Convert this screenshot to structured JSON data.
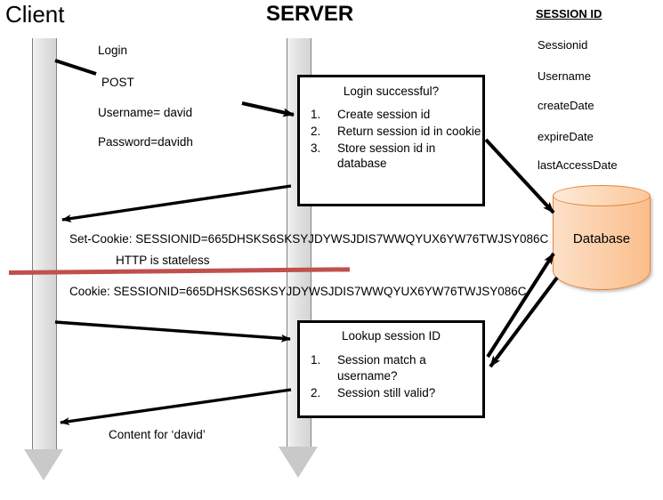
{
  "headings": {
    "client": "Client",
    "server": "SERVER",
    "session": "SESSION ID"
  },
  "session_fields": [
    "Sessionid",
    "Username",
    "createDate",
    "expireDate",
    "lastAccessDate"
  ],
  "client_request": {
    "line1": "Login",
    "line2": "POST",
    "line3": "Username= david",
    "line4": "Password=davidh"
  },
  "server_box_1": {
    "title": "Login successful?",
    "items": [
      {
        "num": "1.",
        "text": "Create session id"
      },
      {
        "num": "2.",
        "text": "Return session id in cookie"
      },
      {
        "num": "3.",
        "text": "Store session id in database"
      }
    ]
  },
  "server_box_2": {
    "title": "Lookup session ID",
    "items": [
      {
        "num": "1.",
        "text": "Session match a username?"
      },
      {
        "num": "2.",
        "text": "Session still valid?"
      }
    ]
  },
  "messages": {
    "set_cookie": "Set-Cookie: SESSIONID=665DHSKS6SKSYJDYWSJDIS7WWQYUX6YW76TWJSY086C",
    "stateless": "HTTP is stateless",
    "cookie": "Cookie: SESSIONID=665DHSKS6SKSYJDYWSJDIS7WWQYUX6YW76TWJSY086C",
    "content": "Content for ‘david’"
  },
  "database": {
    "label": "Database"
  },
  "colors": {
    "red_line": "#c0504d",
    "db_fill": "#fbbe8c",
    "db_stroke": "#e8833a",
    "lifeline": "#d9d9d9",
    "stroke": "#000000"
  }
}
